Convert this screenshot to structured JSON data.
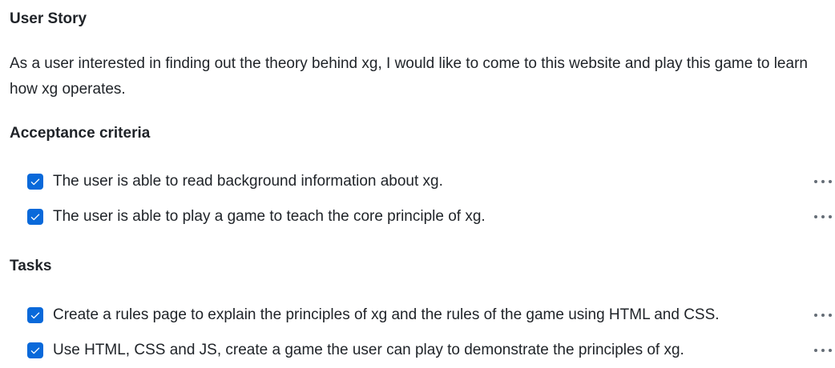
{
  "user_story": {
    "heading": "User Story",
    "text": "As a user interested in finding out the theory behind xg, I would like to come to this website and play this game to learn how xg operates."
  },
  "acceptance": {
    "heading": "Acceptance criteria",
    "items": [
      {
        "label": "The user is able to read background information about xg.",
        "checked": true
      },
      {
        "label": "The user is able to play a game to teach the core principle of xg.",
        "checked": true
      }
    ]
  },
  "tasks": {
    "heading": "Tasks",
    "items": [
      {
        "label": "Create a rules page to explain the principles of xg and the rules of the game using HTML and CSS.",
        "checked": true
      },
      {
        "label": "Use HTML, CSS and JS, create a game the user can play to demonstrate the principles of xg.",
        "checked": true
      }
    ]
  },
  "icons": {
    "checkbox": "check-icon",
    "menu": "kebab-horizontal-icon"
  },
  "colors": {
    "checkbox": "#0969da",
    "text": "#1f2328",
    "muted": "#656d76"
  }
}
